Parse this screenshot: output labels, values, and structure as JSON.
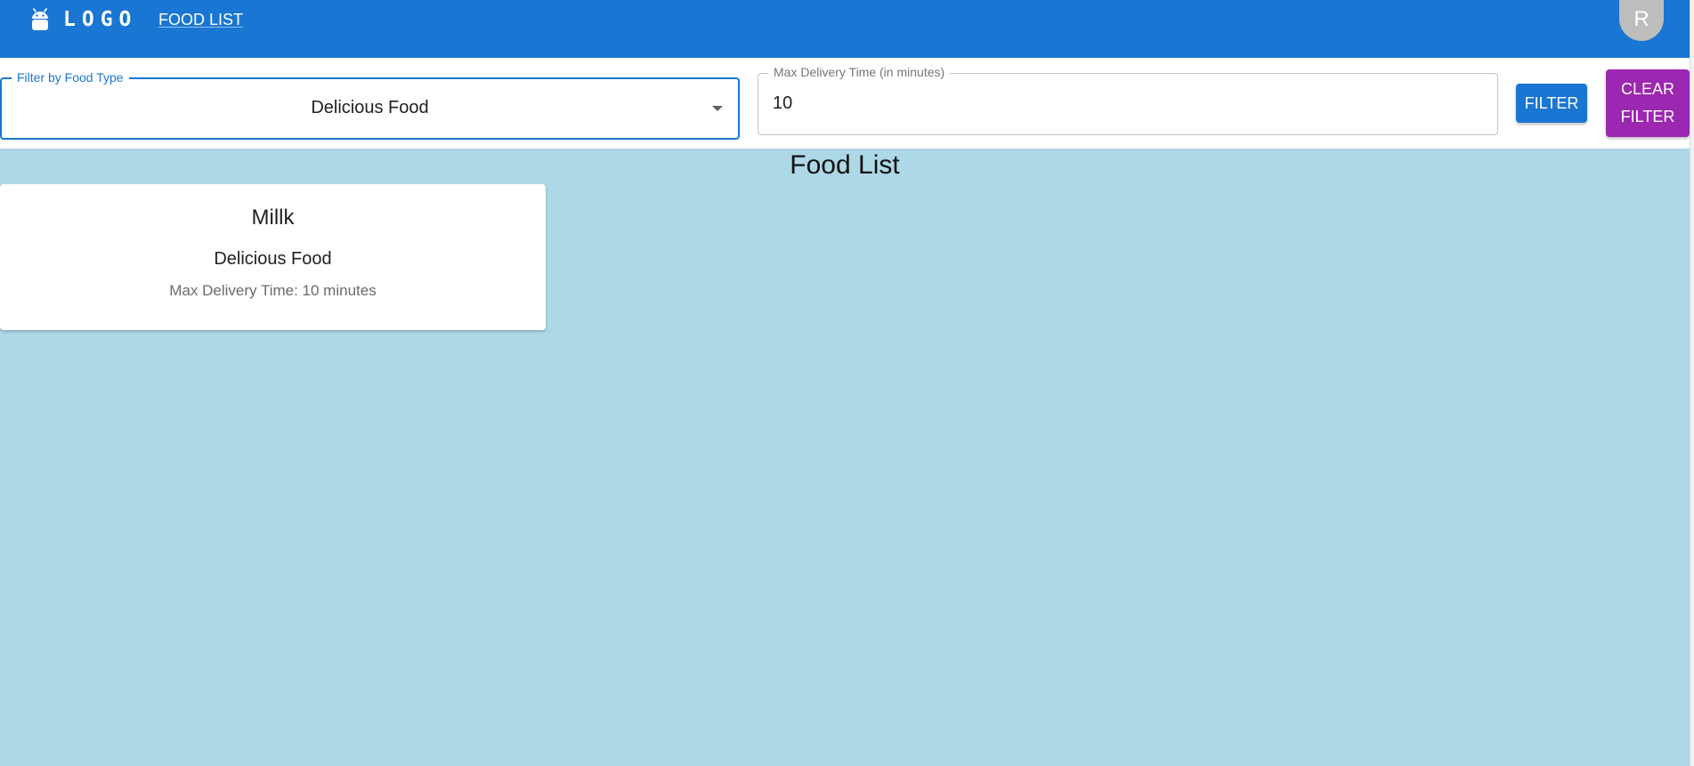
{
  "header": {
    "logo_text": "LOGO",
    "logo_icon": "android-icon",
    "nav_link": "FOOD LIST",
    "avatar_letter": "R",
    "bar_color": "#1976d2"
  },
  "filters": {
    "food_type": {
      "label": "Filter by Food Type",
      "value": "Delicious Food"
    },
    "max_delivery": {
      "label": "Max Delivery Time (in minutes)",
      "value": "10"
    },
    "filter_button": "FILTER",
    "clear_button_line1": "CLEAR",
    "clear_button_line2": "FILTER",
    "filter_color": "#1976d2",
    "clear_color": "#9c27b0"
  },
  "main": {
    "title": "Food List",
    "background": "#add8e6",
    "items": [
      {
        "name": "Millk",
        "type": "Delicious Food",
        "delivery": "Max Delivery Time: 10 minutes"
      }
    ]
  }
}
